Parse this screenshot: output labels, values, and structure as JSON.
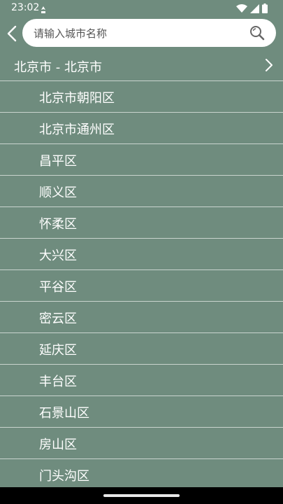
{
  "status_bar": {
    "time": "23:02"
  },
  "search": {
    "placeholder": "请输入城市名称"
  },
  "header": {
    "title": "北京市 - 北京市"
  },
  "districts": [
    "北京市朝阳区",
    "北京市通州区",
    "昌平区",
    "顺义区",
    "怀柔区",
    "大兴区",
    "平谷区",
    "密云区",
    "延庆区",
    "丰台区",
    "石景山区",
    "房山区",
    "门头沟区"
  ],
  "colors": {
    "background": "#6f8c7e",
    "divider": "#c9d4ce",
    "search_bg": "#ffffff"
  }
}
